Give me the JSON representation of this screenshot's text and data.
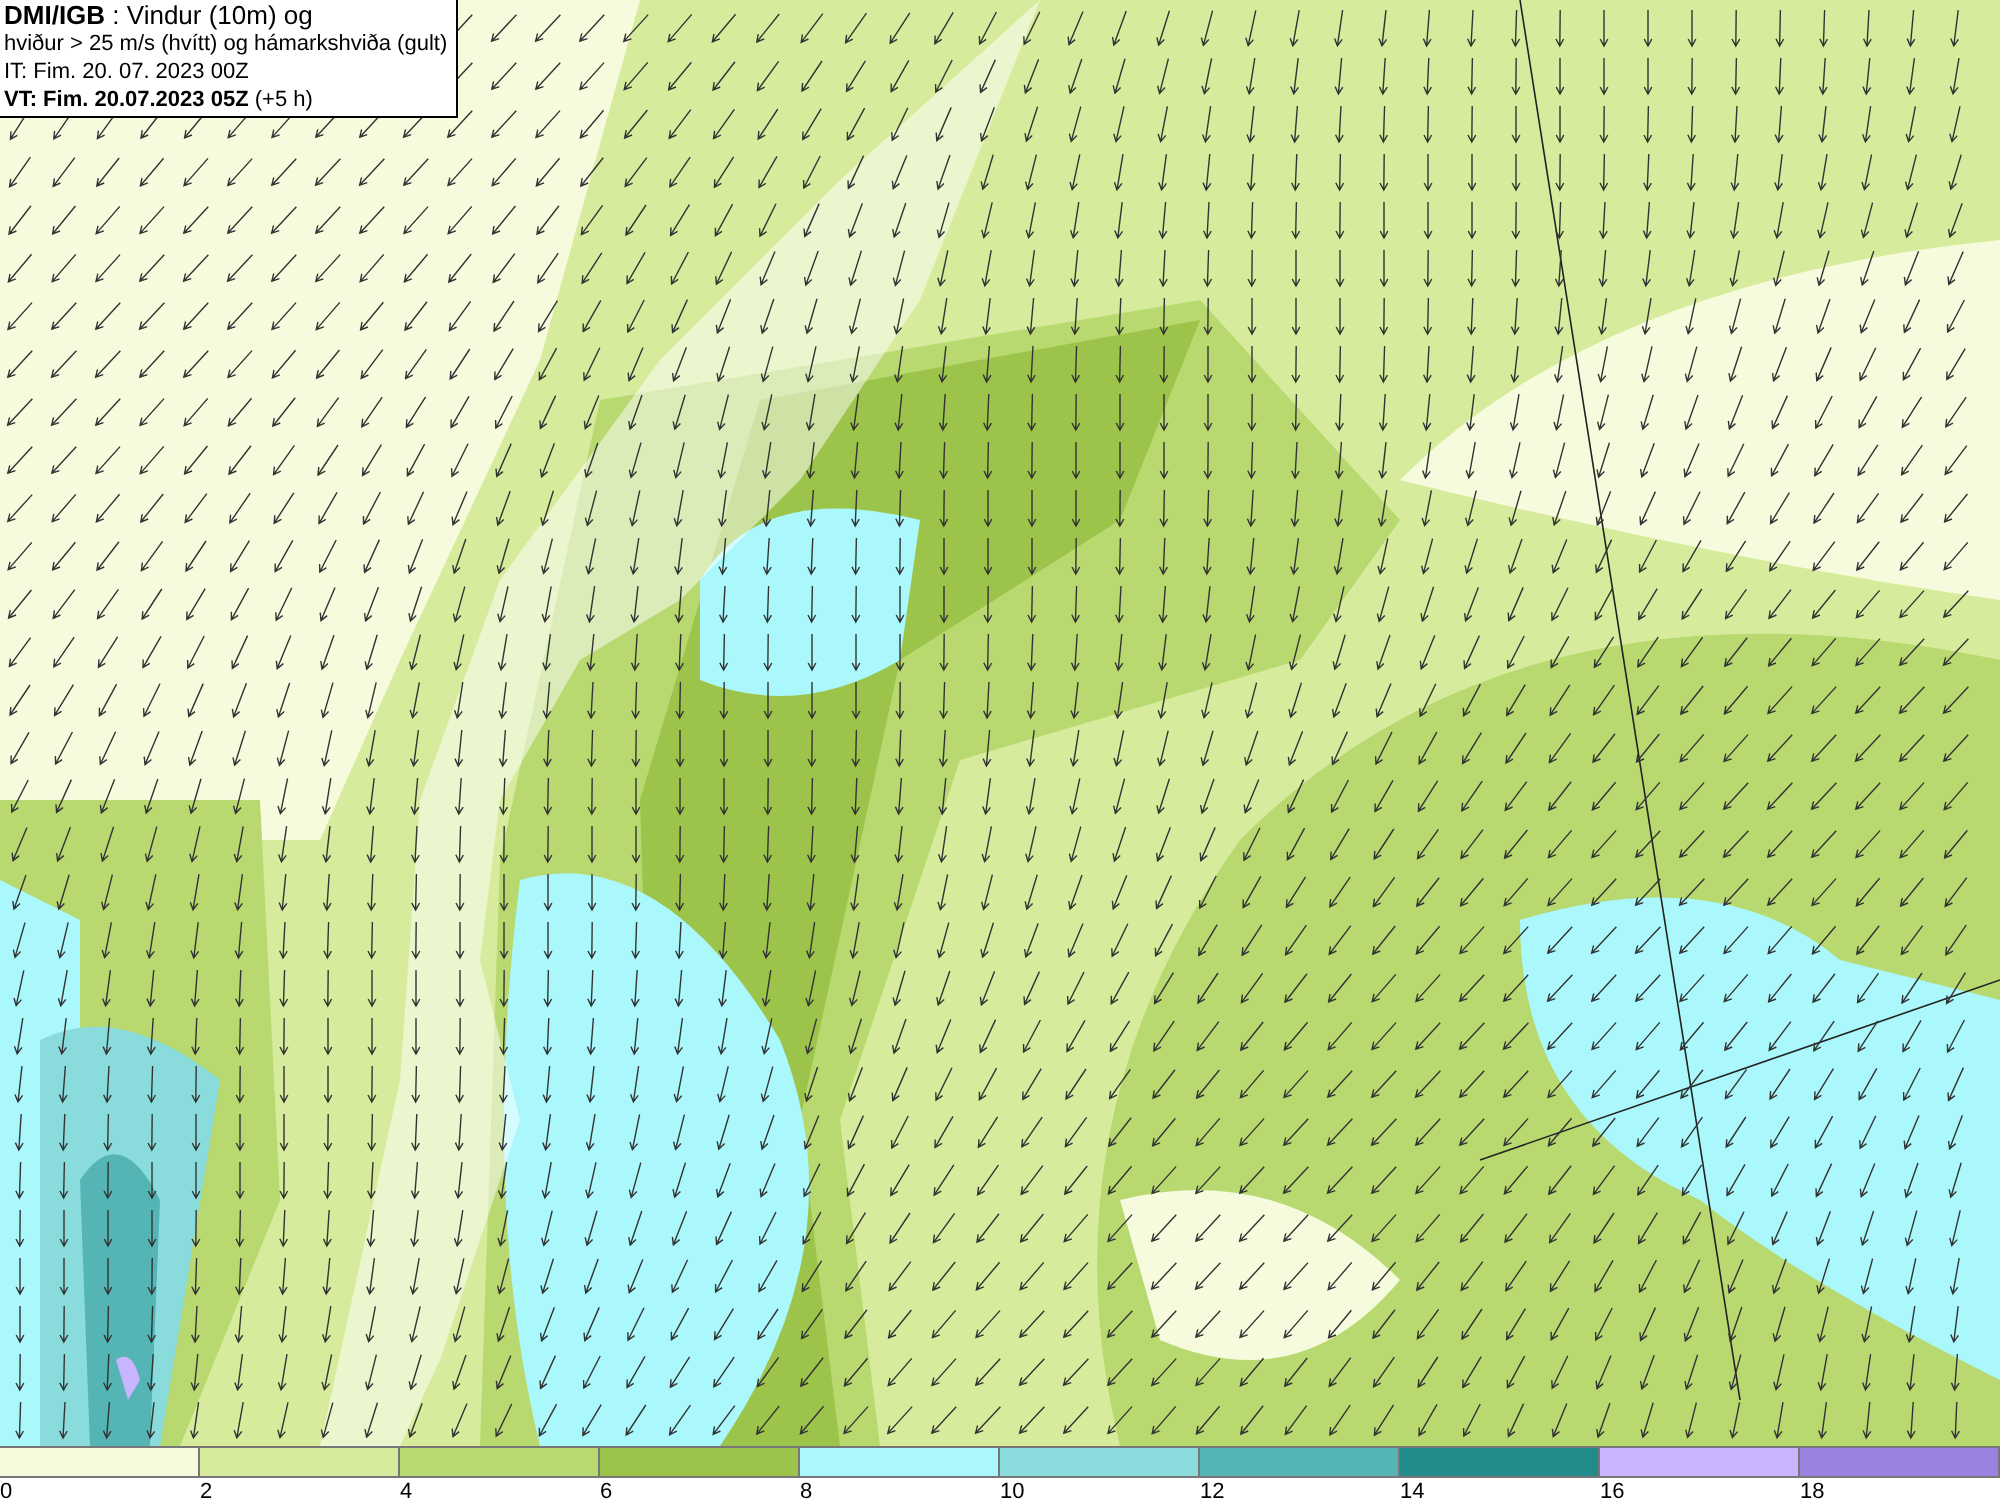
{
  "title_box": {
    "lines": [
      "**DMI/IGB** : Vindur (10m) og",
      "hviður > 25 m/s (hvítt) og hámarkshviða (gult)",
      "IT: Fim. 20. 07. 2023 00Z",
      "**VT: Fim. 20.07.2023 05Z** (+5 h)"
    ]
  },
  "legend": {
    "bins": [
      {
        "label": "0",
        "color": "#f5fbdc"
      },
      {
        "label": "2",
        "color": "#d6ec9c"
      },
      {
        "label": "4",
        "color": "#b8d870"
      },
      {
        "label": "6",
        "color": "#9cc44a"
      },
      {
        "label": "8",
        "color": "#aaf8fc"
      },
      {
        "label": "10",
        "color": "#8adcdc"
      },
      {
        "label": "12",
        "color": "#55b4b4"
      },
      {
        "label": "14",
        "color": "#228c8c"
      },
      {
        "label": "16",
        "color": "#c8b4ff"
      },
      {
        "label": "18",
        "color": "#9b82e0"
      }
    ]
  }
}
